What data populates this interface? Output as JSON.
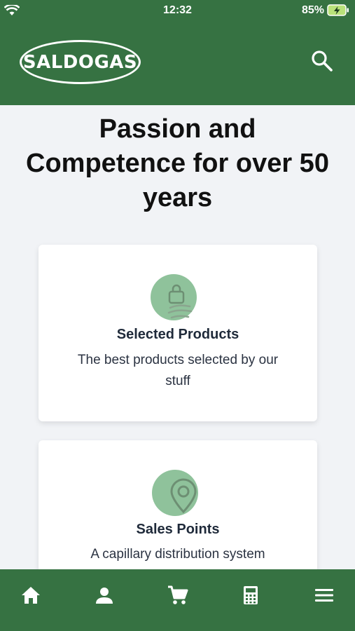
{
  "status_bar": {
    "time": "12:32",
    "battery_percent": "85%",
    "icons": [
      "wifi-icon",
      "battery-charging-icon"
    ]
  },
  "header": {
    "logo_text": "SALDOGAS",
    "search_icon": "search-icon"
  },
  "hero": {
    "title": "Passion and Competence for over 50 years"
  },
  "cards": [
    {
      "icon": "shopping-bag-hand-icon",
      "title": "Selected Products",
      "description": "The best products selected by our stuff"
    },
    {
      "icon": "location-pin-icon",
      "title": "Sales Points",
      "description": "A capillary distribution system"
    }
  ],
  "bottom_nav": [
    {
      "icon": "home-icon"
    },
    {
      "icon": "user-icon"
    },
    {
      "icon": "cart-icon"
    },
    {
      "icon": "calculator-icon"
    },
    {
      "icon": "menu-icon"
    }
  ],
  "colors": {
    "brand_green": "#367242",
    "icon_circle": "#8fc29b",
    "background": "#f1f3f6"
  }
}
